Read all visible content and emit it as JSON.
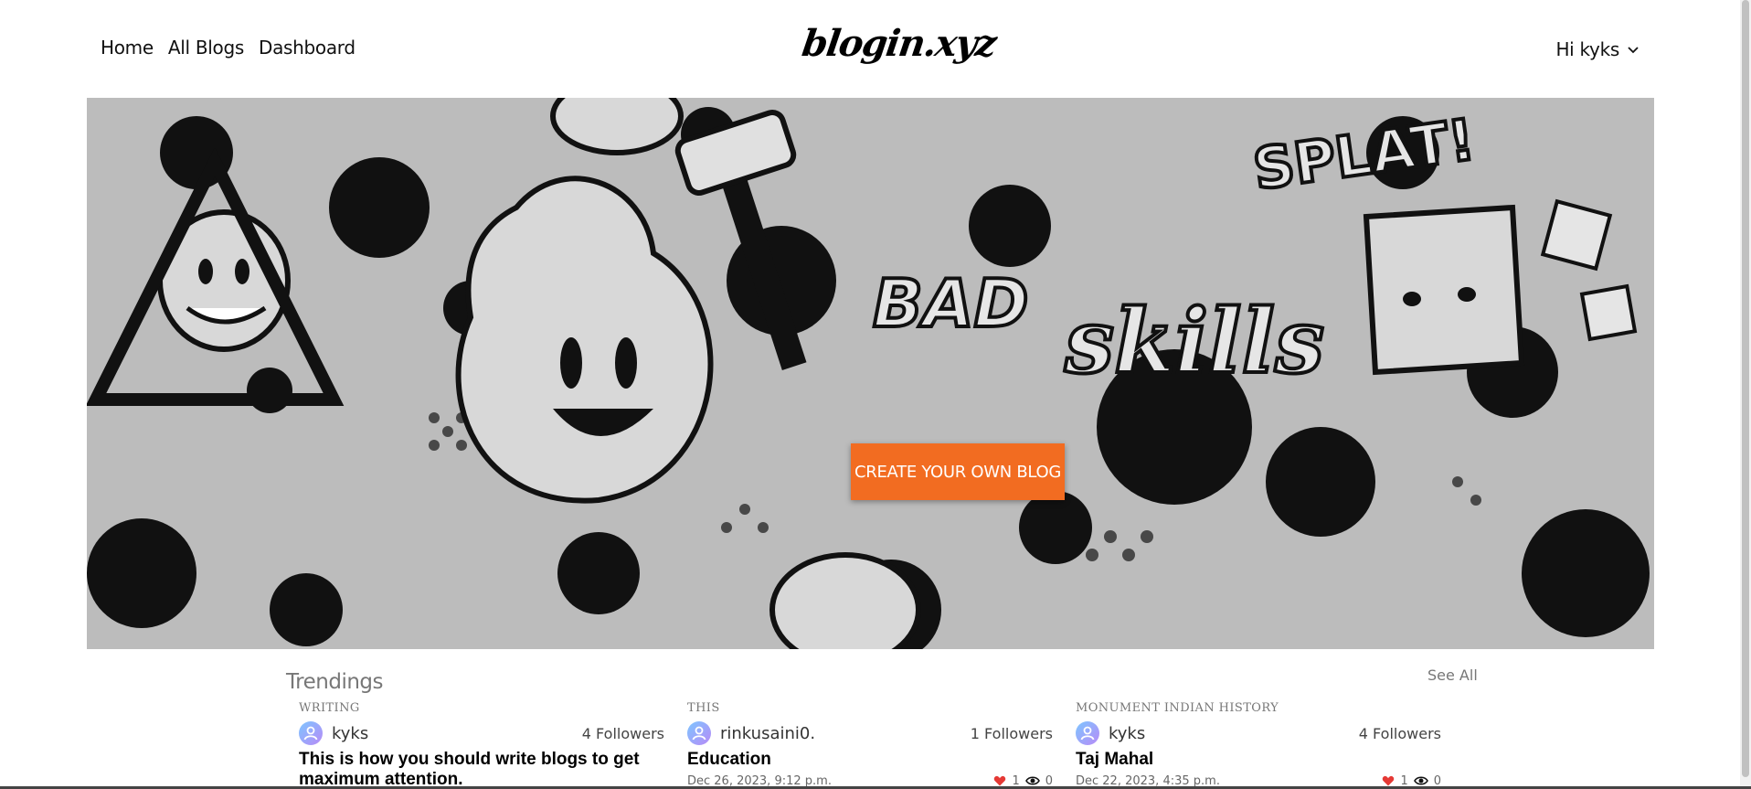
{
  "header": {
    "nav": [
      "Home",
      "All Blogs",
      "Dashboard"
    ],
    "logo": "blogin.xyz",
    "user_greeting": "Hi kyks"
  },
  "hero": {
    "cta_label": "CREATE YOUR OWN BLOG",
    "graffiti_words": [
      "BAD",
      "skills",
      "SPLAT!"
    ]
  },
  "trendings": {
    "title": "Trendings",
    "see_all": "See All",
    "cards": [
      {
        "category": "WRITING",
        "author": "kyks",
        "followers": "4 Followers",
        "title": "This is how you should write blogs to get maximum attention.",
        "date": "",
        "likes": "",
        "views": ""
      },
      {
        "category": "THIS",
        "author": "rinkusaini0.",
        "followers": "1 Followers",
        "title": "Education",
        "date": "Dec 26, 2023, 9:12 p.m.",
        "likes": "1",
        "views": "0"
      },
      {
        "category": "MONUMENT INDIAN HISTORY",
        "author": "kyks",
        "followers": "4 Followers",
        "title": "Taj Mahal",
        "date": "Dec 22, 2023, 4:35 p.m.",
        "likes": "1",
        "views": "0"
      }
    ]
  },
  "colors": {
    "accent": "#f26c21",
    "hero_bg": "#b8b8b8",
    "avatar_gradient": [
      "#7ec6ff",
      "#b78af7"
    ],
    "heart": "#e53935"
  },
  "icons": {
    "dropdown": "chevron-down-icon",
    "avatar": "user-icon",
    "likes": "heart-icon",
    "views": "eye-icon"
  }
}
